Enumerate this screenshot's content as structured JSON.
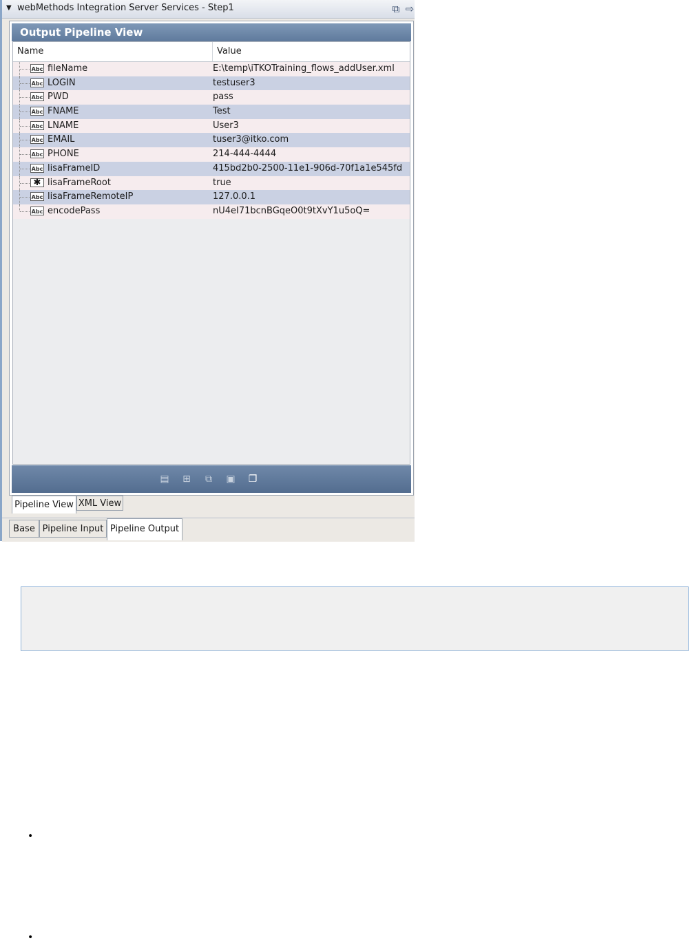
{
  "window": {
    "title": "webMethods Integration Server Services - Step1",
    "caret_icon": "triangle-down-icon",
    "action_icons": [
      "detach-icon",
      "arrow-right-icon"
    ]
  },
  "view": {
    "title": "Output Pipeline View",
    "columns": {
      "name": "Name",
      "value": "Value"
    },
    "rows": [
      {
        "type": "string",
        "type_badge": "Abc",
        "name": "fileName",
        "value": "E:\\temp\\iTKOTraining_flows_addUser.xml"
      },
      {
        "type": "string",
        "type_badge": "Abc",
        "name": "LOGIN",
        "value": "testuser3"
      },
      {
        "type": "string",
        "type_badge": "Abc",
        "name": "PWD",
        "value": "pass"
      },
      {
        "type": "string",
        "type_badge": "Abc",
        "name": "FNAME",
        "value": "Test"
      },
      {
        "type": "string",
        "type_badge": "Abc",
        "name": "LNAME",
        "value": "User3"
      },
      {
        "type": "string",
        "type_badge": "Abc",
        "name": "EMAIL",
        "value": "tuser3@itko.com"
      },
      {
        "type": "string",
        "type_badge": "Abc",
        "name": "PHONE",
        "value": "214-444-4444"
      },
      {
        "type": "string",
        "type_badge": "Abc",
        "name": "lisaFrameID",
        "value": "415bd2b0-2500-11e1-906d-70f1a1e545fd"
      },
      {
        "type": "object",
        "type_badge": "✱",
        "name": "lisaFrameRoot",
        "value": "true"
      },
      {
        "type": "string",
        "type_badge": "Abc",
        "name": "lisaFrameRemoteIP",
        "value": "127.0.0.1"
      },
      {
        "type": "string",
        "type_badge": "Abc",
        "name": "encodePass",
        "value": "nU4eI71bcnBGqeO0t9tXvY1u5oQ="
      }
    ],
    "toolbar_icons": [
      "list-icon",
      "add-icon",
      "copy-icon",
      "paste-icon",
      "duplicate-icon"
    ]
  },
  "view_tabs": [
    {
      "label": "Pipeline View",
      "active": true
    },
    {
      "label": "XML View",
      "active": false
    }
  ],
  "bottom_tabs": [
    {
      "label": "Base",
      "active": false
    },
    {
      "label": "Pipeline Input",
      "active": false
    },
    {
      "label": "Pipeline Output",
      "active": true
    }
  ],
  "document": {
    "bullet_glyph": "•"
  },
  "colors": {
    "header_bar": "#6f88a9",
    "row_odd": "#f6ecee",
    "row_even": "#cad1e3",
    "info_border": "#8fb2d8"
  }
}
